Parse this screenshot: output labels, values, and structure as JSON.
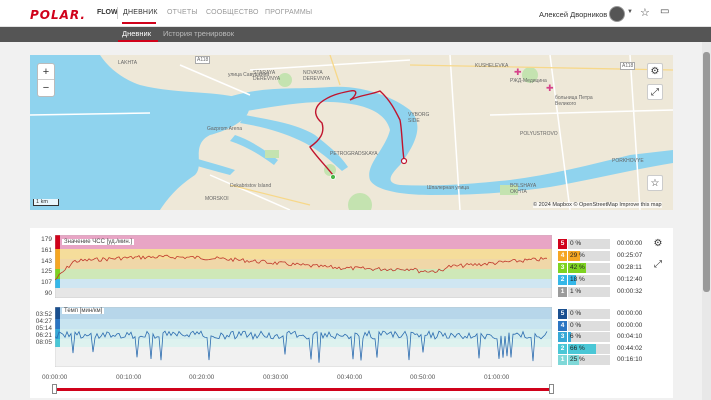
{
  "header": {
    "logo": "POLAR.",
    "flow": "FLOW",
    "nav": [
      "ДНЕВНИК",
      "ОТЧЕТЫ",
      "СООБЩЕСТВО",
      "ПРОГРАММЫ"
    ],
    "user_name": "Алексей Дворников",
    "icons": [
      "star-icon",
      "chat-icon"
    ]
  },
  "subnav": [
    "Дневник",
    "История тренировок"
  ],
  "map": {
    "scale": "1 km",
    "attribution": "© 2024 Mapbox © OpenStreetMap Improve this map",
    "labels": [
      "LAKHTA",
      "STARAYA DEREVNYA",
      "NOVAYA DEREVNYA",
      "KUSHELEVKA",
      "Gazprom Arena",
      "PETROGRADSKAYA",
      "VYBORG SIDE",
      "POLYUSTROVO",
      "BOLSHAYA OKHTA",
      "PORKHOVYE",
      "Dekabristov Island",
      "MORSKOI",
      "РЖД-Медицина",
      "больница Петра Великого",
      "Шпалерная улица",
      "улица Савушкина"
    ],
    "road_shields": [
      "A118",
      "A118"
    ]
  },
  "hr_chart": {
    "label": "Значение ЧСС [уд./мин.]",
    "y_ticks": [
      "179",
      "161",
      "143",
      "125",
      "107",
      "90"
    ],
    "zones": [
      {
        "num": "5",
        "pct": "0 %",
        "time": "00:00:00",
        "color": "#d0021b"
      },
      {
        "num": "4",
        "pct": "29 %",
        "time": "00:25:07",
        "color": "#f5a623"
      },
      {
        "num": "3",
        "pct": "42 %",
        "time": "00:28:11",
        "color": "#7ed321"
      },
      {
        "num": "2",
        "pct": "18 %",
        "time": "00:12:40",
        "color": "#35b7e8"
      },
      {
        "num": "1",
        "pct": "1 %",
        "time": "00:00:32",
        "color": "#9b9b9b"
      }
    ],
    "fills": [
      0,
      0.29,
      0.42,
      0.18,
      0.01
    ]
  },
  "pace_chart": {
    "label": "Темп [мин/км]",
    "y_ticks": [
      "03:52",
      "04:27",
      "05:14",
      "06:21",
      "08:05"
    ],
    "zones": [
      {
        "num": "5",
        "pct": "0 %",
        "time": "00:00:00",
        "color": "#1a4f8f"
      },
      {
        "num": "4",
        "pct": "0 %",
        "time": "00:00:00",
        "color": "#2b75c2"
      },
      {
        "num": "3",
        "pct": "6 %",
        "time": "00:04:10",
        "color": "#35a8d6"
      },
      {
        "num": "2",
        "pct": "66 %",
        "time": "00:44:02",
        "color": "#4ac7d6"
      },
      {
        "num": "1",
        "pct": "25 %",
        "time": "00:16:10",
        "color": "#7fd8d8"
      }
    ],
    "fills": [
      0,
      0,
      0.06,
      0.66,
      0.25
    ]
  },
  "x_ticks": [
    "00:00:00",
    "00:10:00",
    "00:20:00",
    "00:30:00",
    "00:40:00",
    "00:50:00",
    "01:00:00"
  ],
  "colors": {
    "accent": "#d0021b",
    "hr_line": "#c0392b",
    "pace_line": "#2b6cb0"
  }
}
